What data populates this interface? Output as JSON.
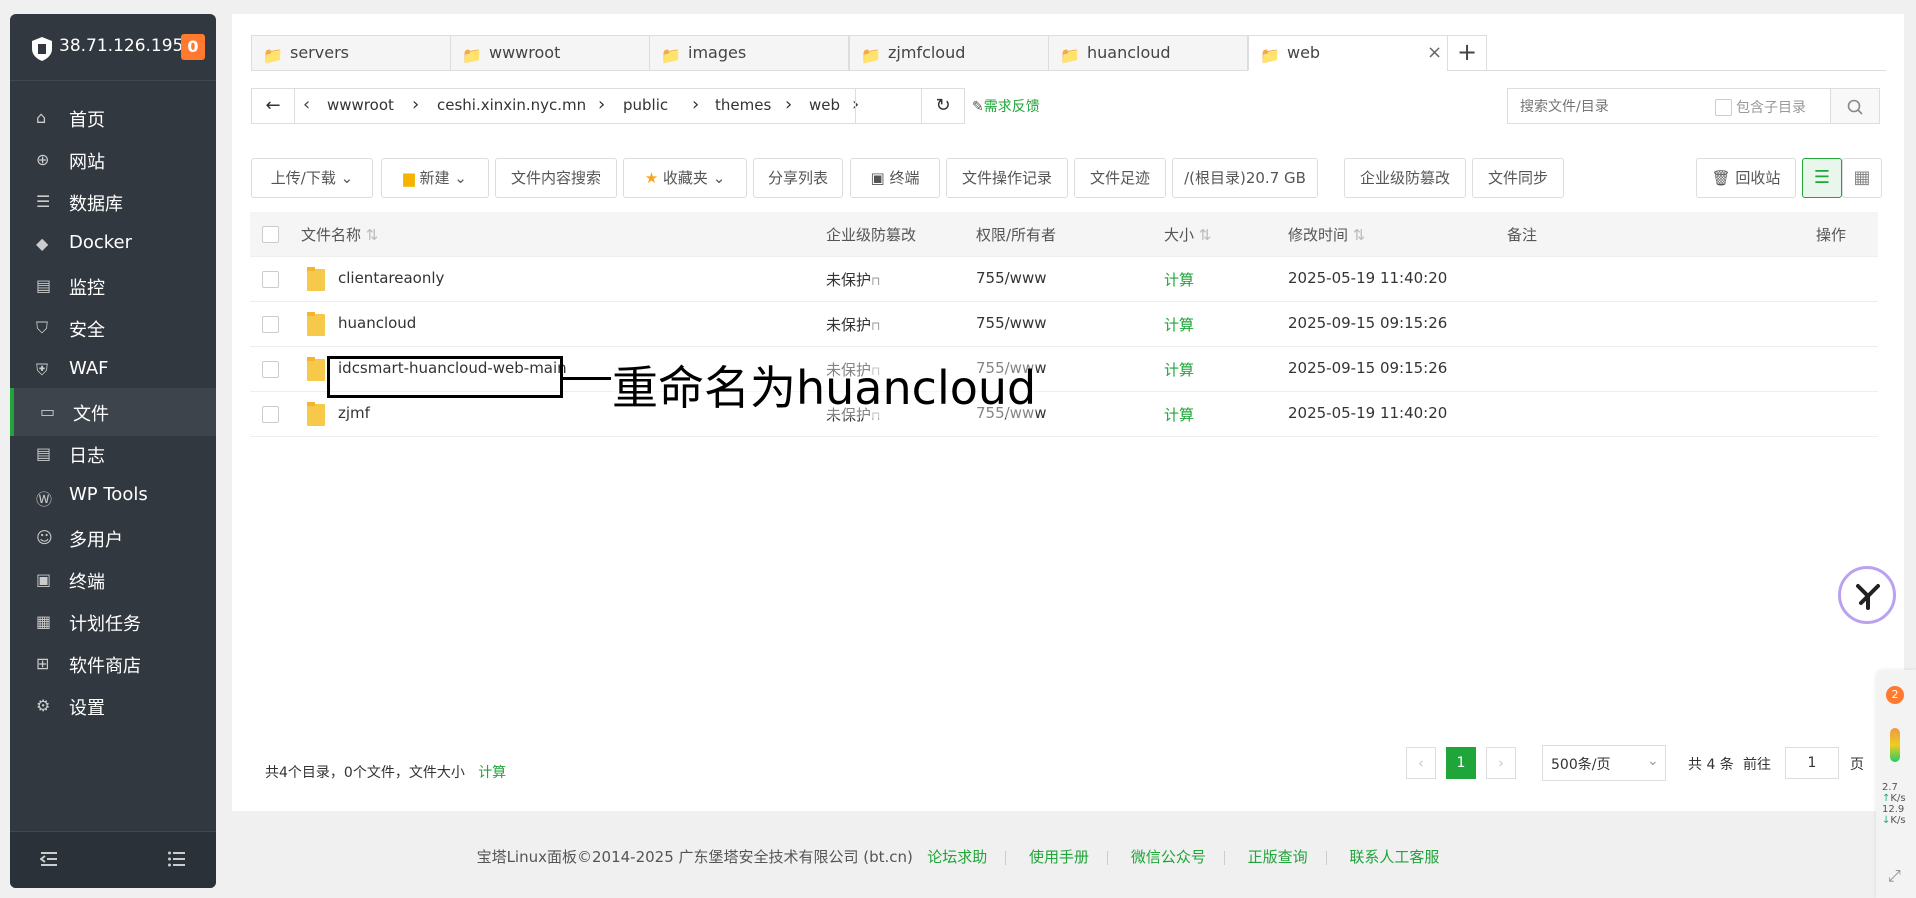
{
  "sidebar": {
    "ip": "38.71.126.195",
    "badge": "0",
    "items": [
      {
        "label": "首页",
        "icon": "home-icon"
      },
      {
        "label": "网站",
        "icon": "globe-icon"
      },
      {
        "label": "数据库",
        "icon": "database-icon"
      },
      {
        "label": "Docker",
        "icon": "docker-icon"
      },
      {
        "label": "监控",
        "icon": "monitor-icon"
      },
      {
        "label": "安全",
        "icon": "shield-icon"
      },
      {
        "label": "WAF",
        "icon": "waf-icon"
      },
      {
        "label": "文件",
        "icon": "folder-icon"
      },
      {
        "label": "日志",
        "icon": "log-icon"
      },
      {
        "label": "WP Tools",
        "icon": "wordpress-icon"
      },
      {
        "label": "多用户",
        "icon": "users-icon"
      },
      {
        "label": "终端",
        "icon": "terminal-icon"
      },
      {
        "label": "计划任务",
        "icon": "calendar-icon"
      },
      {
        "label": "软件商店",
        "icon": "apps-icon"
      },
      {
        "label": "设置",
        "icon": "gear-icon"
      }
    ],
    "active_item": "文件"
  },
  "tabs": [
    {
      "label": "servers"
    },
    {
      "label": "wwwroot"
    },
    {
      "label": "images"
    },
    {
      "label": "zjmfcloud"
    },
    {
      "label": "huancloud"
    },
    {
      "label": "web",
      "active": true
    }
  ],
  "breadcrumb": [
    "wwwroot",
    "ceshi.xinxin.nyc.mn",
    "public",
    "themes",
    "web"
  ],
  "feedback": "需求反馈",
  "search": {
    "placeholder": "搜索文件/目录",
    "include_sub": "包含子目录"
  },
  "toolbar": {
    "upload": "上传/下载",
    "new": "新建",
    "content_search": "文件内容搜索",
    "favorites": "收藏夹",
    "share_list": "分享列表",
    "terminal": "终端",
    "op_log": "文件操作记录",
    "footprint": "文件足迹",
    "disk": "/(根目录)20.7 GB",
    "tamper": "企业级防篡改",
    "sync": "文件同步",
    "recycle": "回收站"
  },
  "table": {
    "headers": {
      "name": "文件名称",
      "tamper": "企业级防篡改",
      "perm": "权限/所有者",
      "size": "大小",
      "mtime": "修改时间",
      "note": "备注",
      "ops": "操作"
    },
    "rows": [
      {
        "name": "clientareaonly",
        "tamper": "未保护",
        "perm": "755/www",
        "size": "计算",
        "mtime": "2025-05-19 11:40:20"
      },
      {
        "name": "huancloud",
        "tamper": "未保护",
        "perm": "755/www",
        "size": "计算",
        "mtime": "2025-09-15 09:15:26"
      },
      {
        "name": "idcsmart-huancloud-web-main",
        "tamper": "未保护",
        "perm": "755/www",
        "size": "计算",
        "mtime": "2025-09-15 09:15:26"
      },
      {
        "name": "zjmf",
        "tamper": "未保护",
        "perm": "755/www",
        "size": "计算",
        "mtime": "2025-05-19 11:40:20"
      }
    ]
  },
  "annotation": "重命名为huancloud",
  "summary": {
    "text": "共4个目录，0个文件，文件大小",
    "calc": "计算"
  },
  "pagination": {
    "page": "1",
    "per_page": "500条/页",
    "total": "共 4 条",
    "goto": "前往",
    "goto_value": "1",
    "page_unit": "页"
  },
  "floating": {
    "badge": "2",
    "up": "2.7",
    "up_unit": "K/s",
    "down": "12.9",
    "down_unit": "K/s"
  },
  "footer": {
    "copyright": "宝塔Linux面板©2014-2025 广东堡塔安全技术有限公司 (bt.cn)",
    "links": [
      "论坛求助",
      "使用手册",
      "微信公众号",
      "正版查询",
      "联系人工客服"
    ]
  }
}
